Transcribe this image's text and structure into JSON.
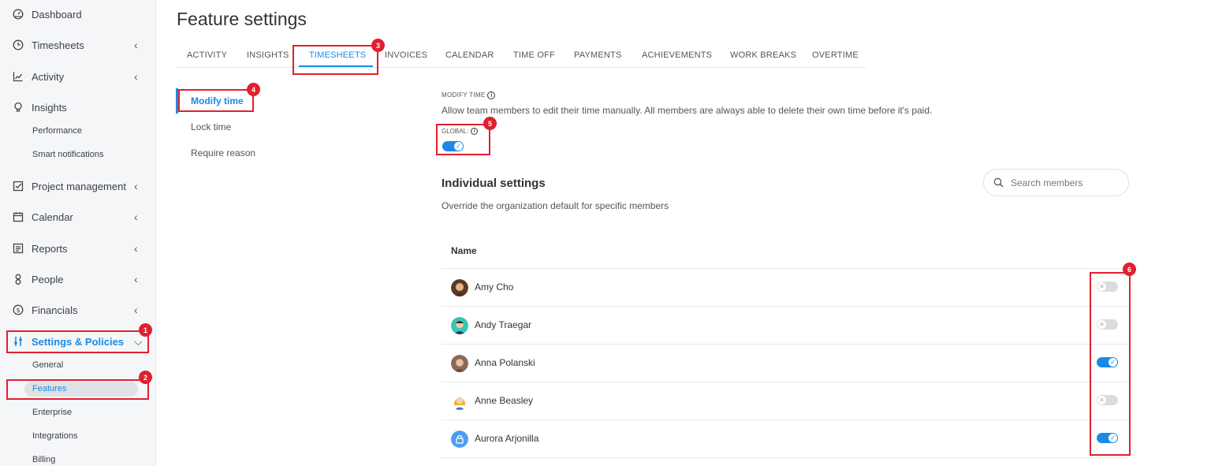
{
  "sidebar": {
    "items": [
      {
        "label": "Dashboard",
        "icon": "dashboard-icon"
      },
      {
        "label": "Timesheets",
        "icon": "clock-icon",
        "chevron": "‹"
      },
      {
        "label": "Activity",
        "icon": "activity-chart-icon",
        "chevron": "‹"
      },
      {
        "label": "Insights",
        "icon": "lightbulb-icon"
      },
      {
        "label": "Project management",
        "icon": "checkbox-icon",
        "chevron": "‹"
      },
      {
        "label": "Calendar",
        "icon": "calendar-icon",
        "chevron": "‹"
      },
      {
        "label": "Reports",
        "icon": "report-icon",
        "chevron": "‹"
      },
      {
        "label": "People",
        "icon": "person-icon",
        "chevron": "‹"
      },
      {
        "label": "Financials",
        "icon": "dollar-icon",
        "chevron": "‹"
      },
      {
        "label": "Settings & Policies",
        "icon": "sliders-icon",
        "chevron": "⌵"
      }
    ],
    "insights_sub": [
      "Performance",
      "Smart notifications"
    ],
    "settings_sub": [
      "General",
      "Features",
      "Enterprise",
      "Integrations",
      "Billing"
    ]
  },
  "page": {
    "title": "Feature settings"
  },
  "tabs": [
    "ACTIVITY",
    "INSIGHTS",
    "TIMESHEETS",
    "INVOICES",
    "CALENDAR",
    "TIME OFF",
    "PAYMENTS",
    "ACHIEVEMENTS",
    "WORK BREAKS",
    "OVERTIME"
  ],
  "active_tab": "TIMESHEETS",
  "submenu": [
    "Modify time",
    "Lock time",
    "Require reason"
  ],
  "modify_time": {
    "label": "MODIFY TIME",
    "description": "Allow team members to edit their time manually. All members are always able to delete their own time before it's paid.",
    "global_label": "GLOBAL:",
    "global_on": true
  },
  "individual": {
    "title": "Individual settings",
    "description": "Override the organization default for specific members",
    "search_placeholder": "Search members",
    "column_name": "Name",
    "members": [
      {
        "name": "Amy Cho",
        "enabled": false
      },
      {
        "name": "Andy Traegar",
        "enabled": false
      },
      {
        "name": "Anna Polanski",
        "enabled": true
      },
      {
        "name": "Anne Beasley",
        "enabled": false
      },
      {
        "name": "Aurora Arjonilla",
        "enabled": true
      }
    ]
  },
  "annotations": [
    "1",
    "2",
    "3",
    "4",
    "5",
    "6"
  ],
  "colors": {
    "accent": "#1a8ae6",
    "annotation": "#e0202f"
  }
}
